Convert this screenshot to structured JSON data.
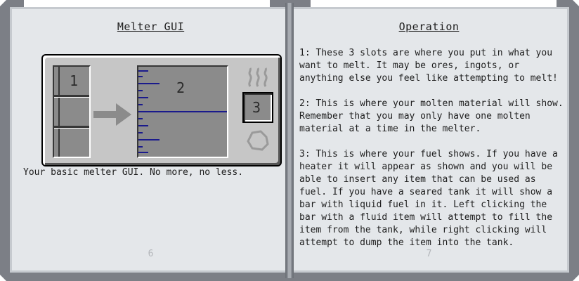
{
  "left_page": {
    "title": "Melter GUI",
    "caption": "Your basic melter GUI. No more, no less.",
    "page_number": "6",
    "gui": {
      "slot_label": "1",
      "tank_label": "2",
      "fuel_label": "3",
      "tank_color": "#1a1a8c",
      "icons": [
        "arrow-right-icon",
        "heat-waves-icon",
        "stone-outline-icon"
      ]
    }
  },
  "right_page": {
    "title": "Operation",
    "paragraphs": [
      "1: These 3 slots are where you put in what you want to melt. It may be ores, ingots, or anything else you feel like attempting to melt!",
      "2: This is where your molten material will show. Remember that you may only have one molten material at a time in the melter.",
      "3: This is where your fuel shows. If you have a heater it will appear as shown and you will be able to insert any item that can be used as fuel. If you have a seared tank it will show a bar with liquid fuel in it. Left clicking the bar with a fluid item will attempt to fill the item from the tank, while right clicking will attempt to dump the item into the tank."
    ],
    "page_number": "7"
  }
}
